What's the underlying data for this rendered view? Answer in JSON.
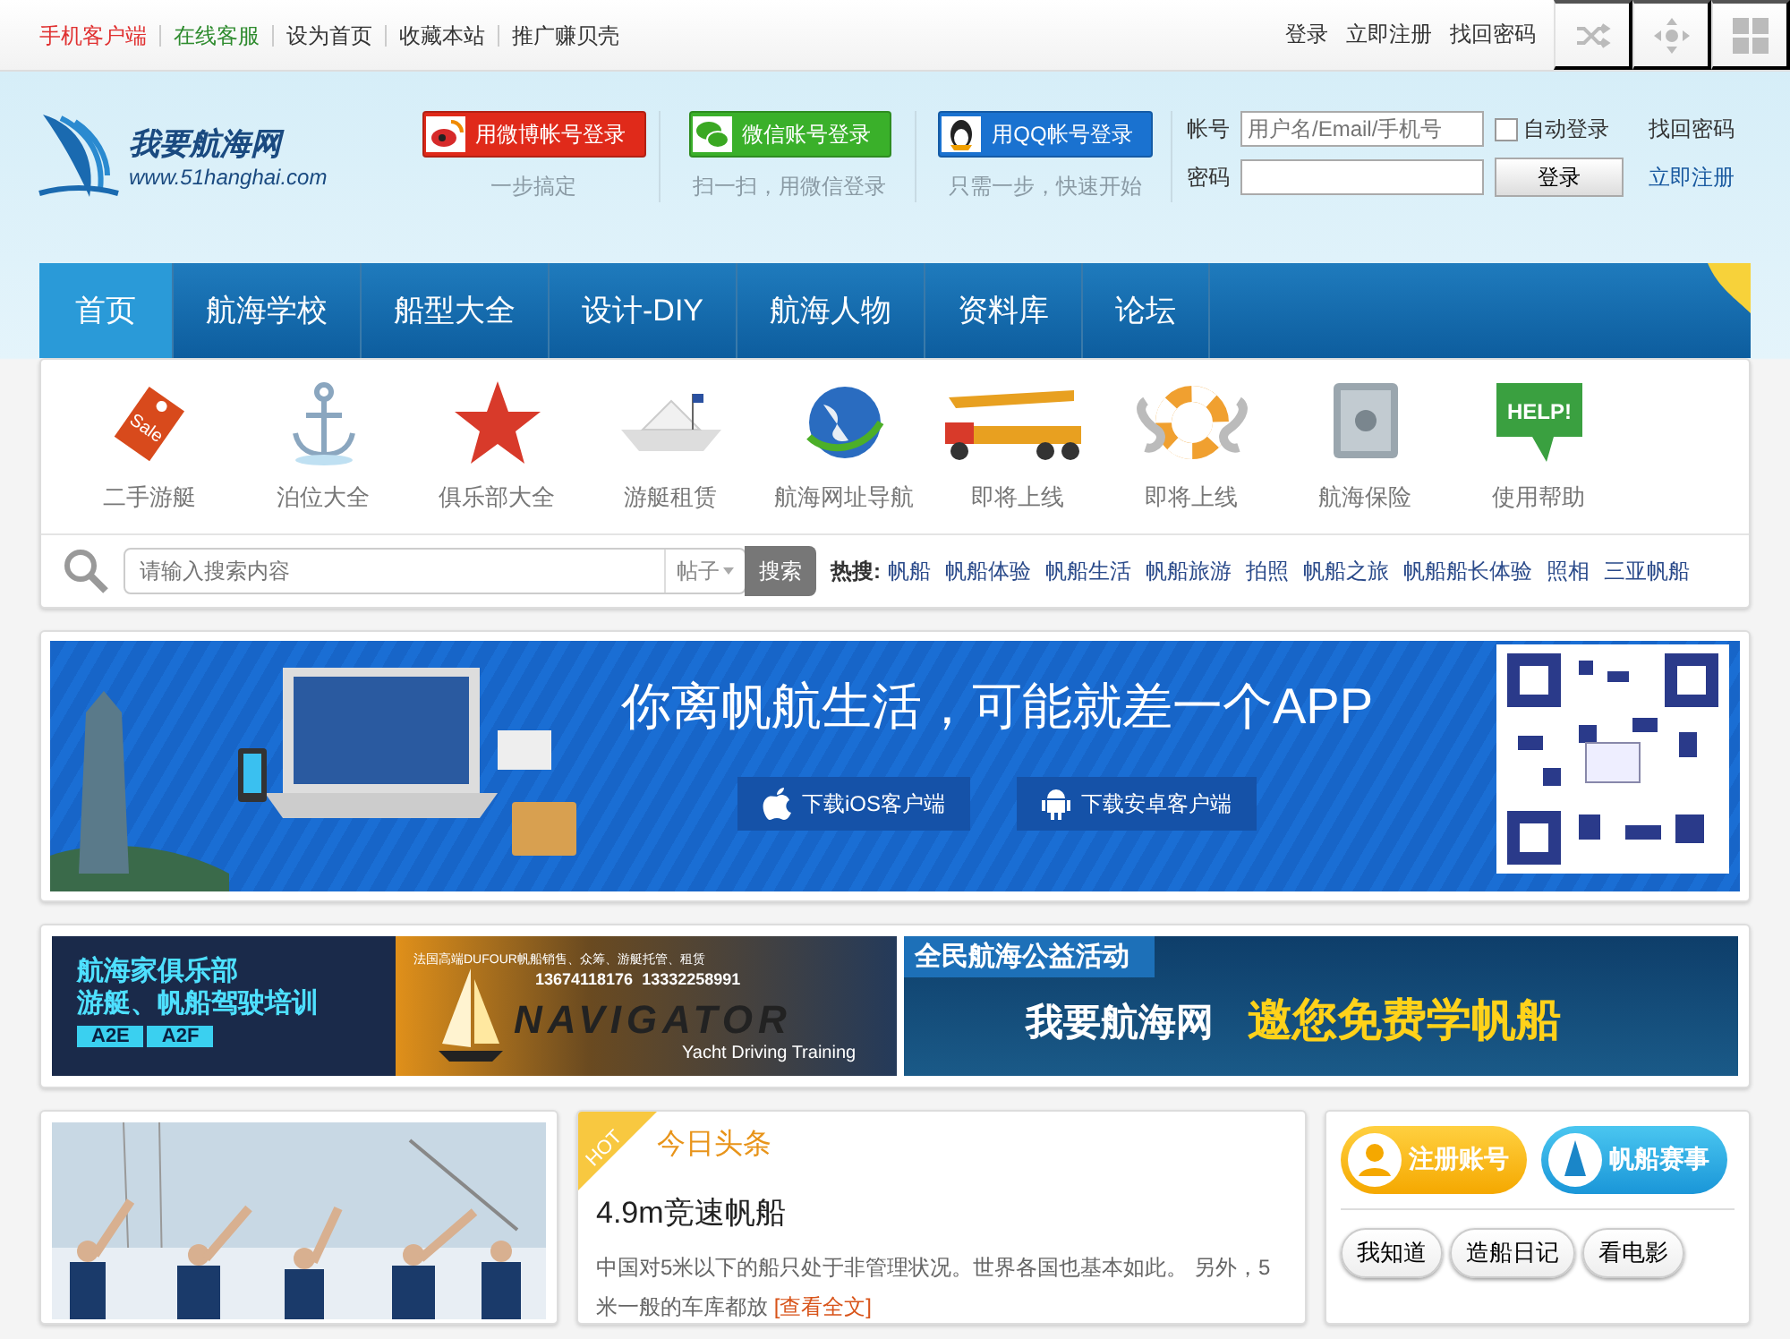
{
  "topbar": {
    "links": [
      {
        "label": "手机客户端",
        "color": "#e03030"
      },
      {
        "label": "在线客服",
        "color": "#2e8b2e"
      },
      {
        "label": "设为首页",
        "color": "#333333"
      },
      {
        "label": "收藏本站",
        "color": "#333333"
      },
      {
        "label": "推广赚贝壳",
        "color": "#333333"
      }
    ],
    "account_links": [
      "登录",
      "立即注册",
      "找回密码"
    ]
  },
  "header": {
    "logo": {
      "name": "我要航海网",
      "url": "www.51hanghai.com"
    },
    "social_logins": [
      {
        "kind": "weibo",
        "label": "用微博帐号登录",
        "caption": "一步搞定"
      },
      {
        "kind": "wechat",
        "label": "微信账号登录",
        "caption": "扫一扫，用微信登录"
      },
      {
        "kind": "qq",
        "label": "用QQ帐号登录",
        "caption": "只需一步，快速开始"
      }
    ],
    "login": {
      "account_label": "帐号",
      "account_placeholder": "用户名/Email/手机号",
      "auto_login": {
        "label": "自动登录",
        "checked": false
      },
      "password_label": "密码",
      "submit": "登录",
      "forgot": "找回密码",
      "register": "立即注册"
    }
  },
  "nav": [
    {
      "label": "首页",
      "selected": true
    },
    {
      "label": "航海学校",
      "selected": false
    },
    {
      "label": "船型大全",
      "selected": false
    },
    {
      "label": "设计-DIY",
      "selected": false
    },
    {
      "label": "航海人物",
      "selected": false
    },
    {
      "label": "资料库",
      "selected": false
    },
    {
      "label": "论坛",
      "selected": false
    }
  ],
  "categories": [
    {
      "kind": "tag",
      "badge": "Sale",
      "label": "二手游艇"
    },
    {
      "kind": "anchor",
      "label": "泊位大全"
    },
    {
      "kind": "star",
      "label": "俱乐部大全"
    },
    {
      "kind": "boat",
      "label": "游艇租赁"
    },
    {
      "kind": "globe",
      "label": "航海网址导航"
    },
    {
      "kind": "crane",
      "label": "即将上线"
    },
    {
      "kind": "lifebuoy",
      "label": "即将上线"
    },
    {
      "kind": "safe",
      "label": "航海保险"
    },
    {
      "kind": "help",
      "badge": "HELP!",
      "label": "使用帮助"
    }
  ],
  "search": {
    "placeholder": "请输入搜索内容",
    "scope": "帖子",
    "button": "搜索",
    "hot_label": "热搜:",
    "hot": [
      "帆船",
      "帆船体验",
      "帆船生活",
      "帆船旅游",
      "拍照",
      "帆船之旅",
      "帆船船长体验",
      "照相",
      "三亚帆船"
    ]
  },
  "app_banner": {
    "headline": "你离帆航生活，可能就差一个APP",
    "buttons": [
      {
        "kind": "ios",
        "label": "下载iOS客户端"
      },
      {
        "kind": "android",
        "label": "下载安卓客户端"
      }
    ]
  },
  "promo_left": {
    "title": "航海家俱乐部",
    "subtitle": "游艇、帆船驾驶培训",
    "tags": [
      "A2E",
      "A2F"
    ],
    "note": "法国高端DUFOUR帆船销售、众筹、游艇托管、租赁",
    "phones": "13674118176  13332258991",
    "brand": "NAVIGATOR",
    "tagline": "Yacht Driving Training"
  },
  "promo_right": {
    "title": "全民航海公益活动",
    "name": "我要航海网",
    "slogan": "邀您免费学帆船"
  },
  "news": {
    "badge": "HOT",
    "section": "今日头条",
    "title": "4.9m竞速帆船",
    "summary": "中国对5米以下的船只处于非管理状况。世界各国也基本如此。 另外，5米一般的车库都放",
    "more": "[查看全文]"
  },
  "side": {
    "buttons": [
      {
        "kind": "user",
        "label": "注册账号"
      },
      {
        "kind": "sail",
        "label": "帆船赛事"
      }
    ],
    "tags": [
      "我知道",
      "造船日记",
      "看电影"
    ]
  }
}
